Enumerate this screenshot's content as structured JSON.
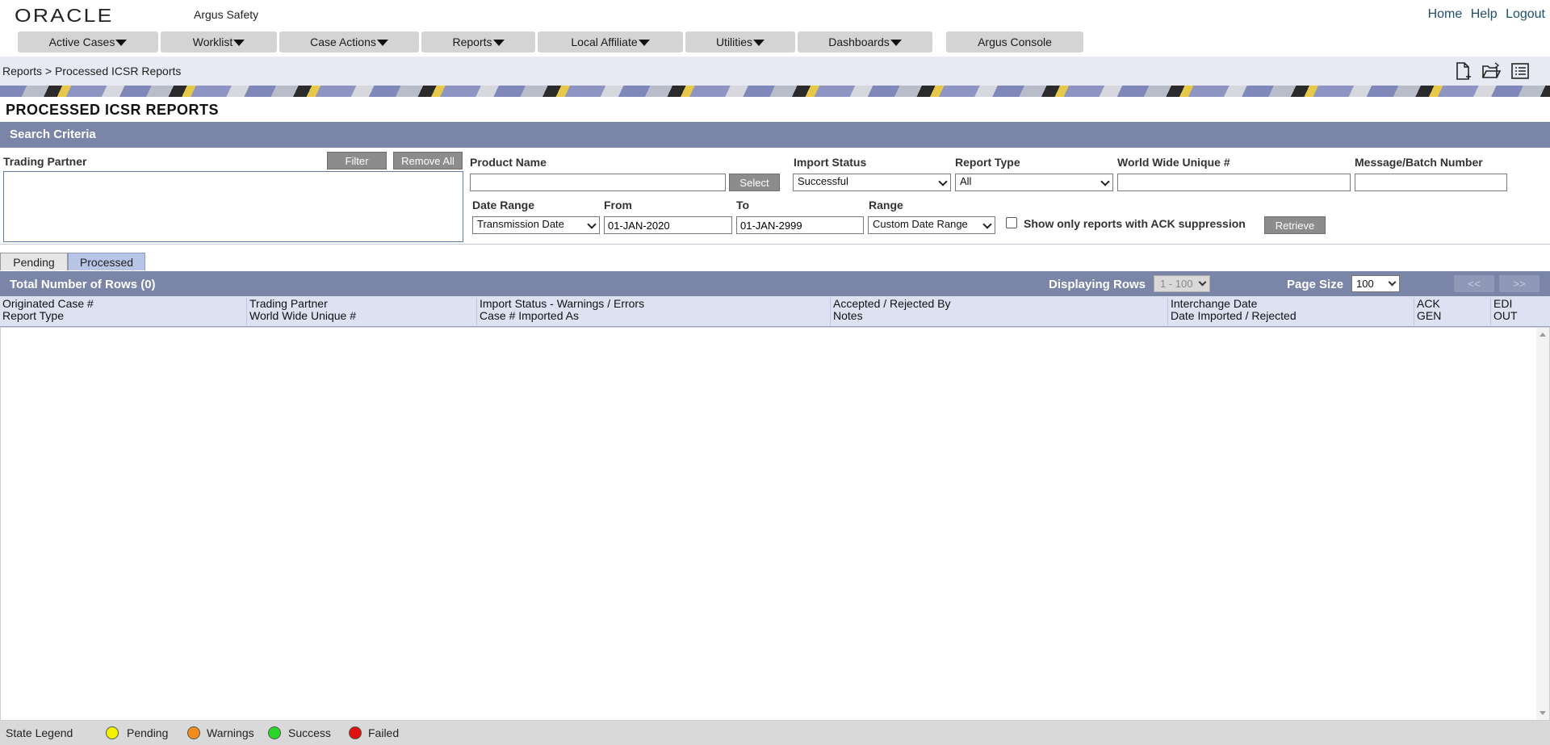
{
  "header": {
    "logo": "ORACLE",
    "app_name": "Argus Safety",
    "links": [
      "Home",
      "Help",
      "Logout"
    ]
  },
  "nav": [
    {
      "label": "Active Cases",
      "dropdown": true
    },
    {
      "label": "Worklist",
      "dropdown": true
    },
    {
      "label": "Case Actions",
      "dropdown": true
    },
    {
      "label": "Reports",
      "dropdown": true
    },
    {
      "label": "Local Affiliate",
      "dropdown": true
    },
    {
      "label": "Utilities",
      "dropdown": true
    },
    {
      "label": "Dashboards",
      "dropdown": true
    },
    {
      "label": "Argus Console",
      "dropdown": false
    }
  ],
  "breadcrumb": "Reports > Processed ICSR Reports",
  "toolbar_icons": [
    "new-document-icon",
    "open-folder-icon",
    "list-icon"
  ],
  "page_title": "PROCESSED ICSR REPORTS",
  "search": {
    "header": "Search Criteria",
    "trading_partner_label": "Trading Partner",
    "filter_button": "Filter",
    "remove_all_button": "Remove All",
    "product_name_label": "Product Name",
    "product_name_value": "",
    "select_button": "Select",
    "import_status_label": "Import Status",
    "import_status_value": "Successful",
    "report_type_label": "Report Type",
    "report_type_value": "All",
    "wwuid_label": "World Wide Unique #",
    "wwuid_value": "",
    "batch_label": "Message/Batch Number",
    "batch_value": "",
    "date_range_label": "Date Range",
    "date_range_value": "Transmission Date",
    "from_label": "From",
    "from_value": "01-JAN-2020",
    "to_label": "To",
    "to_value": "01-JAN-2999",
    "range_label": "Range",
    "range_value": "Custom Date Range",
    "ack_checkbox_label": "Show only reports with ACK suppression",
    "retrieve_button": "Retrieve"
  },
  "tabs": [
    {
      "label": "Pending",
      "active": false
    },
    {
      "label": "Processed",
      "active": true
    }
  ],
  "results": {
    "total_label": "Total Number of Rows (0)",
    "displaying_label": "Displaying Rows",
    "displaying_value": "1 - 100",
    "page_size_label": "Page Size",
    "page_size_value": "100",
    "prev": "<<",
    "next": ">>",
    "columns": [
      [
        "Originated Case #",
        "Report Type"
      ],
      [
        "Trading Partner",
        "World Wide Unique #"
      ],
      [
        "Import Status - Warnings / Errors",
        "Case # Imported As"
      ],
      [
        "Accepted / Rejected By",
        "Notes"
      ],
      [
        "Interchange Date",
        "Date Imported / Rejected"
      ],
      [
        "ACK",
        "GEN"
      ],
      [
        "EDI",
        "OUT"
      ]
    ],
    "rows": []
  },
  "legend": {
    "title": "State Legend",
    "items": [
      {
        "label": "Pending",
        "color": "#f2f200"
      },
      {
        "label": "Warnings",
        "color": "#f28c1c"
      },
      {
        "label": "Success",
        "color": "#2ad52a"
      },
      {
        "label": "Failed",
        "color": "#e01010"
      }
    ]
  }
}
